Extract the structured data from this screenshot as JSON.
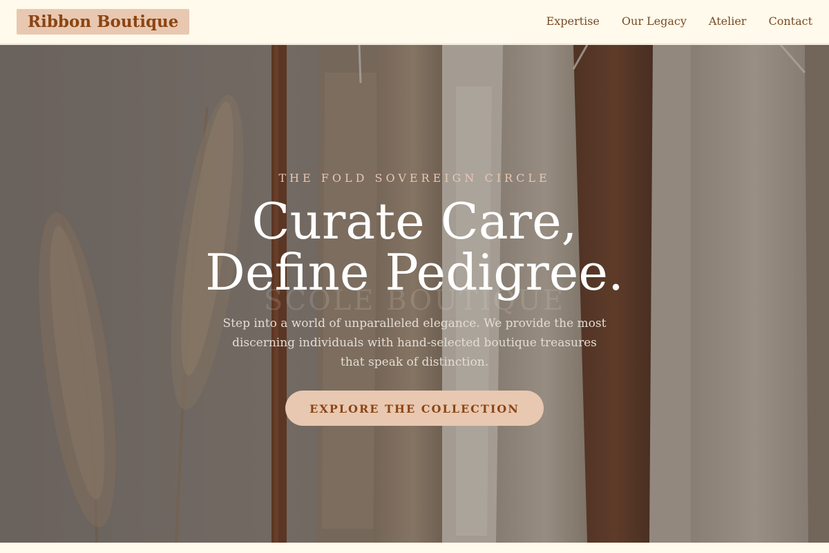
{
  "header": {
    "brand": "Ribbon Boutique",
    "nav": [
      {
        "label": "Expertise"
      },
      {
        "label": "Our Legacy"
      },
      {
        "label": "Atelier"
      },
      {
        "label": "Contact"
      }
    ]
  },
  "hero": {
    "eyebrow": "THE FOLD SOVEREIGN CIRCLE",
    "headline_line1": "Curate Care,",
    "headline_line2": "Define Pedigree.",
    "faint_text": "SCOLE BOUTIQUE",
    "lead": "Step into a world of unparalleled elegance. We provide the most discerning individuals with hand-selected boutique treasures that speak of distinction.",
    "cta_label": "EXPLORE THE COLLECTION",
    "background_icon": "clothing-rack-photo"
  },
  "colors": {
    "page_background": "#fffaec",
    "brand_background": "#e8c8b1",
    "brand_text": "#8b4513",
    "nav_text": "#7a4a22",
    "headline": "#ffffff",
    "eyebrow": "#e8c8b1",
    "cta_background": "#e8c8b1",
    "cta_text": "#8b4513"
  }
}
